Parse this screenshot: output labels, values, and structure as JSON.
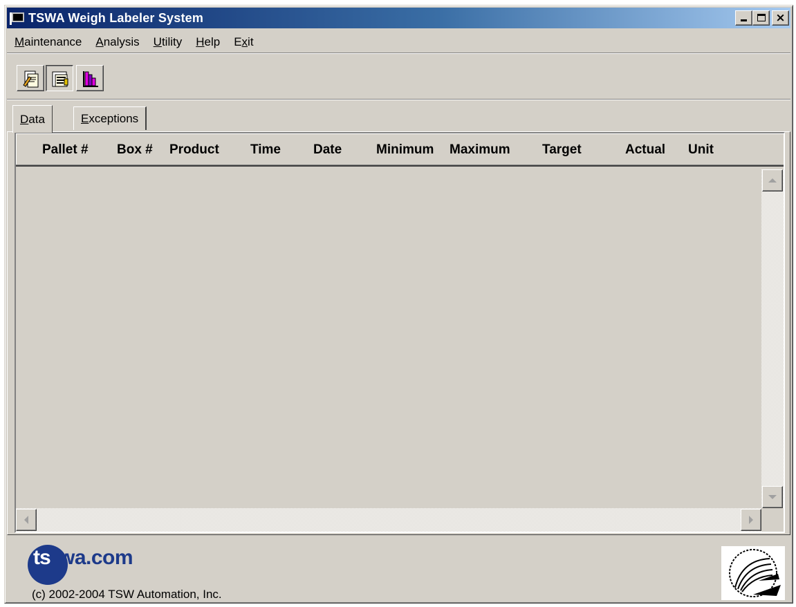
{
  "window": {
    "title": "TSWA Weigh Labeler System",
    "controls": {
      "minimize": "_",
      "maximize": "□",
      "close": "×"
    }
  },
  "menu": [
    {
      "label": "Maintenance",
      "accel": "M"
    },
    {
      "label": "Analysis",
      "accel": "A"
    },
    {
      "label": "Utility",
      "accel": "U"
    },
    {
      "label": "Help",
      "accel": "H"
    },
    {
      "label": "Exit",
      "accel": "x"
    }
  ],
  "toolbar": {
    "buttons": [
      {
        "icon": "document-edit-icon",
        "pressed": false
      },
      {
        "icon": "clipboard-data-icon",
        "pressed": true
      },
      {
        "icon": "bar-chart-icon",
        "pressed": false
      }
    ]
  },
  "tabs": [
    {
      "label": "Data",
      "active": true
    },
    {
      "label": "Exceptions",
      "active": false
    }
  ],
  "grid": {
    "columns": [
      "Pallet #",
      "Box #",
      "Product",
      "Time",
      "Date",
      "Minimum",
      "Maximum",
      "Target",
      "Actual",
      "Unit"
    ],
    "rows": []
  },
  "footer": {
    "logo_ts": "ts",
    "logo_rest": "wa.com",
    "copyright": "(c) 2002-2004 TSW Automation, Inc.",
    "seal_icon": "company-seal-icon"
  },
  "colors": {
    "face": "#d4d0c8",
    "title_start": "#0a246a",
    "title_end": "#a6caf0",
    "logo_blue": "#1d3a8a"
  }
}
